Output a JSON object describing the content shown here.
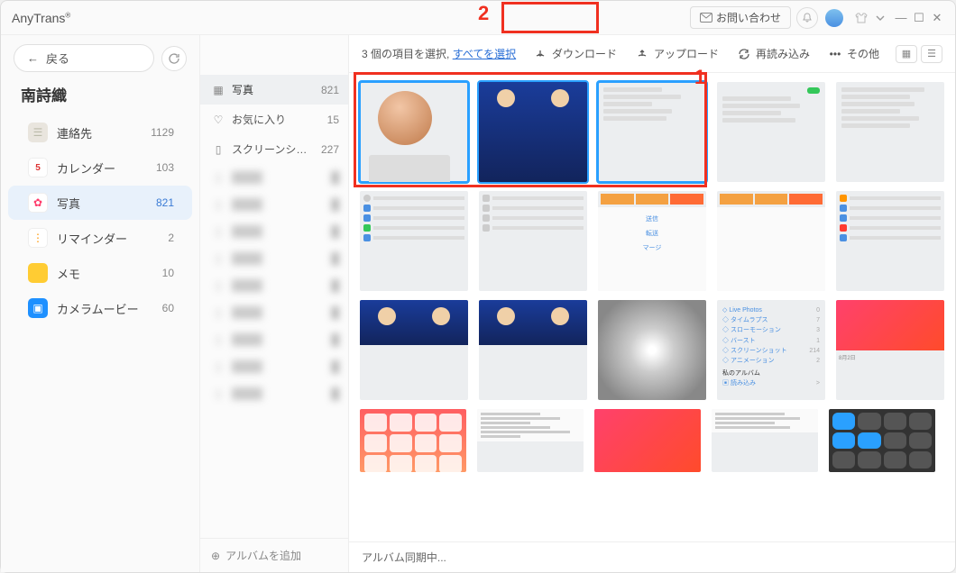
{
  "app": {
    "title": "AnyTrans",
    "trademark": "®"
  },
  "titlebar": {
    "contact": "お問い合わせ"
  },
  "sidebar": {
    "back": "戻る",
    "device": "南詩織",
    "items": [
      {
        "label": "連絡先",
        "count": "1129",
        "icon_bg": "#e9e5de",
        "glyph": "☰"
      },
      {
        "label": "カレンダー",
        "count": "103",
        "icon_bg": "#ffffff",
        "glyph": "5",
        "glyph_color": "#d33"
      },
      {
        "label": "写真",
        "count": "821",
        "icon_bg": "#ffffff",
        "glyph": "✿",
        "glyph_color": "#ff3b6b",
        "active": true
      },
      {
        "label": "リマインダー",
        "count": "2",
        "icon_bg": "#ffffff",
        "glyph": "⋮",
        "glyph_color": "#ff9500"
      },
      {
        "label": "メモ",
        "count": "10",
        "icon_bg": "#ffcc33",
        "glyph": ""
      },
      {
        "label": "カメラムービー",
        "count": "60",
        "icon_bg": "#1e90ff",
        "glyph": "▣"
      }
    ]
  },
  "albums": {
    "add": "アルバムを追加",
    "items": [
      {
        "label": "写真",
        "count": "821",
        "active": true,
        "icon": "grid"
      },
      {
        "label": "お気に入り",
        "count": "15",
        "icon": "heart"
      },
      {
        "label": "スクリーンショ...",
        "count": "227",
        "icon": "phone"
      }
    ]
  },
  "toolbar": {
    "selection_prefix": "3 個の項目を選択, ",
    "select_all": "すべてを選択",
    "download": "ダウンロード",
    "upload": "アップロード",
    "reload": "再読み込み",
    "more": "その他"
  },
  "status": {
    "sync": "アルバム同期中..."
  },
  "annotations": {
    "one": "1",
    "two": "2"
  },
  "album_ui_rows": [
    {
      "l": "Live Photos",
      "c": "0"
    },
    {
      "l": "タイムラプス",
      "c": "7"
    },
    {
      "l": "スローモーション",
      "c": "3"
    },
    {
      "l": "バースト",
      "c": "1"
    },
    {
      "l": "スクリーンショット",
      "c": "214"
    },
    {
      "l": "アニメーション",
      "c": "2"
    }
  ],
  "album_ui_footer": {
    "header": "私のアルバム",
    "more": "読み込み"
  }
}
